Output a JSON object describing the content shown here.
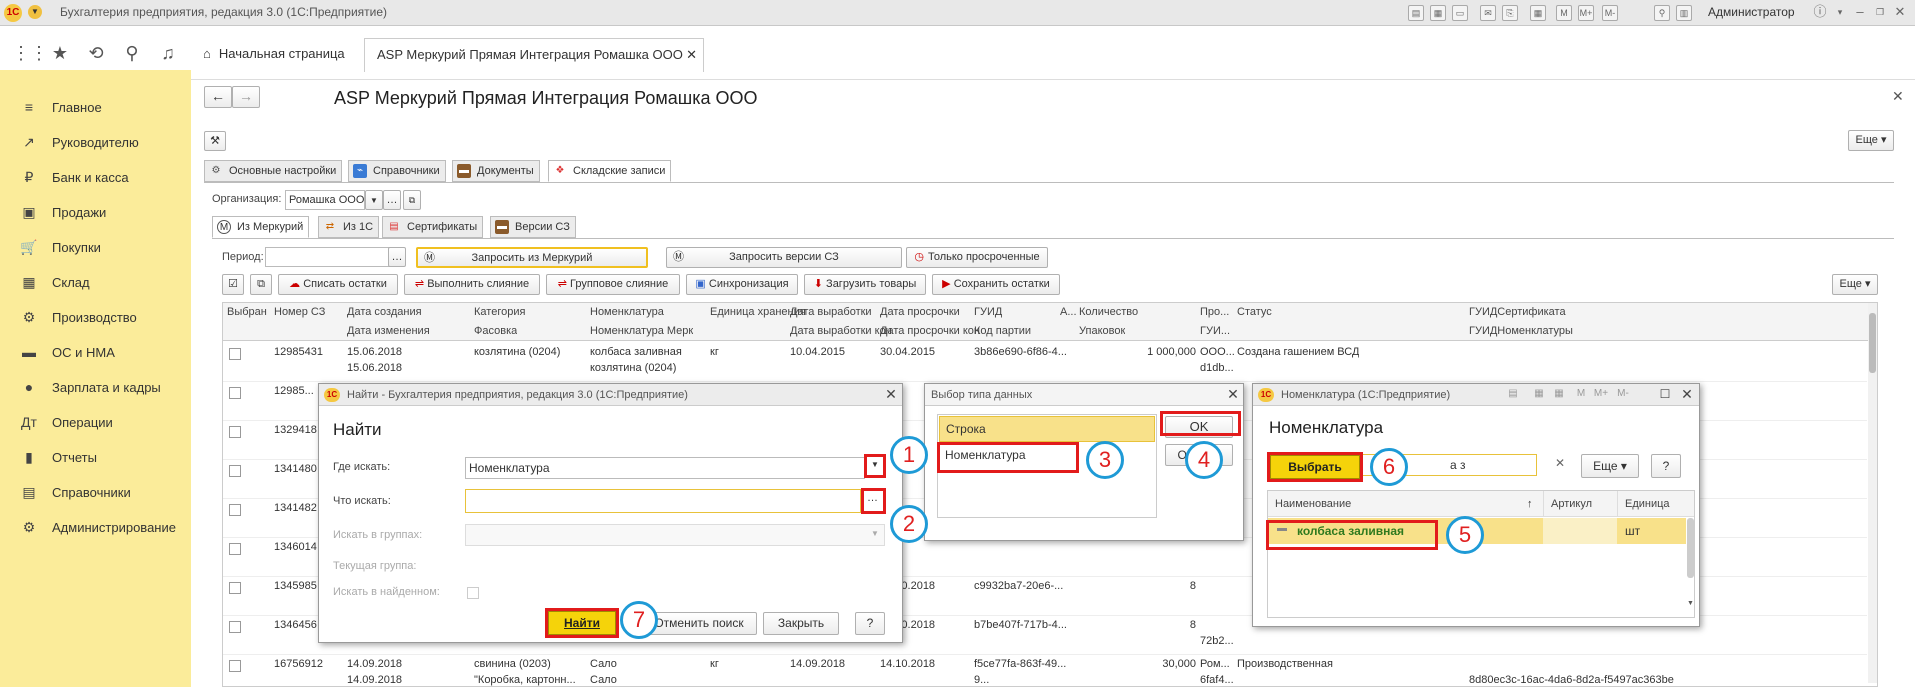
{
  "titlebar": {
    "logo": "1С",
    "title": "Бухгалтерия предприятия, редакция 3.0 (1С:Предприятие)",
    "user": "Администратор"
  },
  "navbar": {
    "home_tab": "Начальная страница",
    "active_tab": "ASP Меркурий Прямая Интеграция Ромашка ООО"
  },
  "sidebar": {
    "items": [
      {
        "label": "Главное",
        "icon": "≡"
      },
      {
        "label": "Руководителю",
        "icon": "↗"
      },
      {
        "label": "Банк и касса",
        "icon": "₽"
      },
      {
        "label": "Продажи",
        "icon": "▣"
      },
      {
        "label": "Покупки",
        "icon": "🛒"
      },
      {
        "label": "Склад",
        "icon": "▦"
      },
      {
        "label": "Производство",
        "icon": "⚙"
      },
      {
        "label": "ОС и НМА",
        "icon": "▬"
      },
      {
        "label": "Зарплата и кадры",
        "icon": "●"
      },
      {
        "label": "Операции",
        "icon": "Дт"
      },
      {
        "label": "Отчеты",
        "icon": "▮"
      },
      {
        "label": "Справочники",
        "icon": "▤"
      },
      {
        "label": "Администрирование",
        "icon": "⚙"
      }
    ]
  },
  "main": {
    "title": "ASP Меркурий Прямая Интеграция Ромашка ООО",
    "more": "Еще",
    "tabs": [
      "Основные настройки",
      "Справочники",
      "Документы",
      "Складские записи"
    ],
    "org_label": "Организация:",
    "org_value": "Ромашка ООО",
    "subtabs": [
      "Из Меркурий",
      "Из 1С",
      "Сертификаты",
      "Версии СЗ"
    ],
    "period_label": "Период:",
    "request_btn": "Запросить из Меркурий",
    "request_versions_btn": "Запросить версии СЗ",
    "expired_btn": "Только просроченные",
    "actions": [
      "Списать остатки",
      "Выполнить слияние",
      "Групповое слияние",
      "Синхронизация",
      "Загрузить товары",
      "Сохранить остатки"
    ],
    "columns_top": [
      "Выбран",
      "Номер СЗ",
      "Дата создания",
      "Категория",
      "Номенклатура",
      "Единица хранения",
      "Дата выработки",
      "Дата просрочки",
      "ГУИД",
      "А...",
      "Количество",
      "Про...",
      "Статус",
      "ГУИДСертификата"
    ],
    "columns_bottom": [
      "Дата изменения",
      "Фасовка",
      "Номенклатура Мерк",
      "Дата выработки кон",
      "Дата просрочки кон",
      "Код партии",
      "Упаковок",
      "ГУИ...",
      "ГУИДНоменклатуры"
    ],
    "rows": [
      {
        "num": "12985431",
        "date1": "15.06.2018",
        "date2": "15.06.2018",
        "cat": "козлятина (0204)",
        "nom": "колбаса заливная",
        "nom2": "козлятина (0204)",
        "unit": "кг",
        "prod": "10.04.2015",
        "exp": "30.04.2015",
        "guid": "3b86e690-6f86-4...",
        "qty": "1 000,000",
        "pro": "ООО...",
        "pro2": "d1db...",
        "status": "Создана гашением ВСД",
        "guid2": ""
      },
      {
        "num": "12985..."
      },
      {
        "num": "1329418"
      },
      {
        "num": "1341480"
      },
      {
        "num": "1341482"
      },
      {
        "num": "1346014"
      },
      {
        "num": "1345985",
        "exp": "10.10.2018",
        "guid": "c9932ba7-20e6-...",
        "qty": "8"
      },
      {
        "num": "1346456",
        "exp": "10.10.2018",
        "guid": "b7be407f-717b-4...",
        "qty": "8",
        "pro2": "72b2..."
      },
      {
        "num": "16756912",
        "date1": "14.09.2018",
        "date2": "14.09.2018",
        "cat": "свинина (0203)",
        "cat2": "\"Коробка, картонн...",
        "nom": "Сало",
        "nom2": "Сало",
        "unit": "кг",
        "prod": "14.09.2018",
        "exp": "14.10.2018",
        "guid": "f5ce77fa-863f-49...",
        "guid_b": "9...",
        "qty": "30,000",
        "pro": "Ром...",
        "pro2": "6faf4...",
        "status": "Производственная",
        "guid2": "8d80ec3c-16ac-4da6-8d2a-f5497ac363be"
      }
    ]
  },
  "find_dialog": {
    "title": "Найти - Бухгалтерия предприятия, редакция 3.0 (1С:Предприятие)",
    "heading": "Найти",
    "where_label": "Где искать:",
    "where_value": "Номенклатура",
    "what_label": "Что искать:",
    "groups_label": "Искать в группах:",
    "current_group_label": "Текущая группа:",
    "in_found_label": "Искать в найденном:",
    "find_btn": "Найти",
    "cancel_btn": "Отменить поиск",
    "close_btn": "Закрыть",
    "help_btn": "?"
  },
  "type_dialog": {
    "title": "Выбор типа данных",
    "items": [
      "Строка",
      "Номенклатура"
    ],
    "ok_btn": "OK",
    "cancel_btn": "Отмена"
  },
  "nom_dialog": {
    "title": "Номенклатура (1С:Предприятие)",
    "heading": "Номенклатура",
    "select_btn": "Выбрать",
    "search_value": "а з",
    "more_btn": "Еще",
    "help_btn": "?",
    "col_name": "Наименование",
    "col_article": "Артикул",
    "col_unit": "Единица",
    "row_name": "колбаса заливная",
    "row_unit": "шт"
  },
  "callouts": [
    "1",
    "2",
    "3",
    "4",
    "5",
    "6",
    "7"
  ],
  "colors": {
    "sidebar": "#fbec9a",
    "accent_yellow": "#f5d30a",
    "callout_border": "#1e9ad6",
    "highlight_red": "#e21b1b"
  }
}
